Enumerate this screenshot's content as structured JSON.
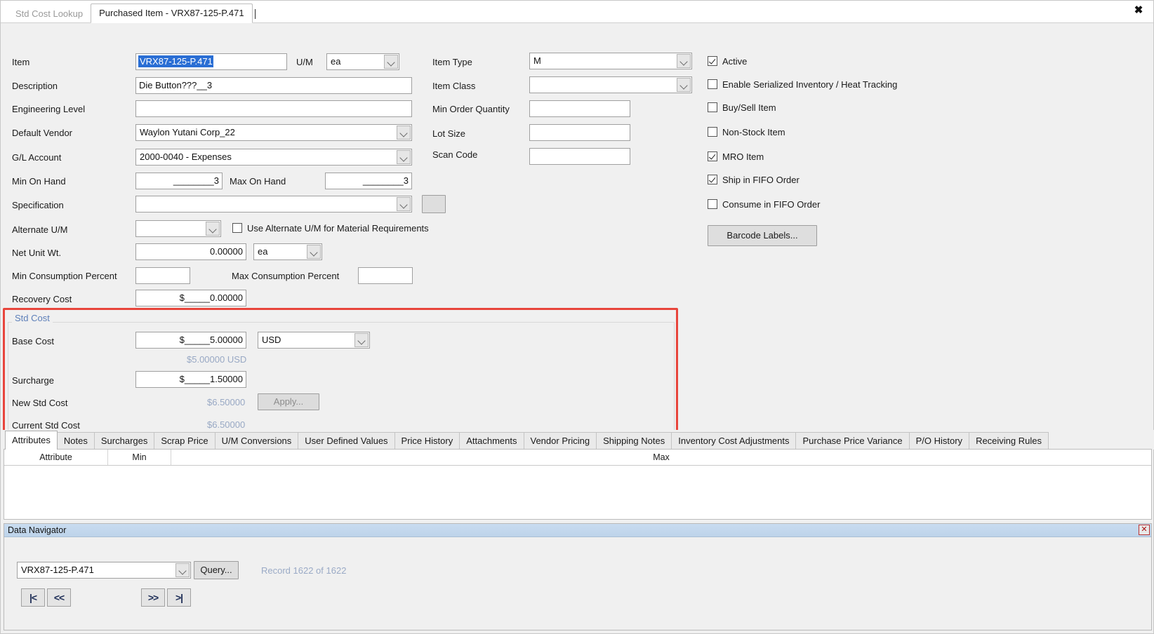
{
  "window": {
    "close_label": "✖"
  },
  "doc_tabs": [
    {
      "label": "Std Cost Lookup",
      "active": false
    },
    {
      "label": "Purchased Item - VRX87-125-P.471",
      "active": true
    }
  ],
  "form": {
    "left_fields": {
      "item_label": "Item",
      "item_value": "VRX87-125-P.471",
      "um_label": "U/M",
      "um_value": "ea",
      "description_label": "Description",
      "description_value": "Die Button???__3",
      "engineering_level_label": "Engineering Level",
      "engineering_level_value": "",
      "default_vendor_label": "Default Vendor",
      "default_vendor_value": "Waylon Yutani Corp_22",
      "gl_account_label": "G/L Account",
      "gl_account_value": "2000-0040 - Expenses",
      "min_on_hand_label": "Min On Hand",
      "min_on_hand_value": "________3",
      "max_on_hand_label": "Max On Hand",
      "max_on_hand_value": "________3",
      "specification_label": "Specification",
      "specification_value": "",
      "alternate_um_label": "Alternate U/M",
      "alternate_um_value": "",
      "use_alt_um_label": "Use Alternate U/M for Material Requirements",
      "use_alt_um_checked": false,
      "net_unit_wt_label": "Net Unit Wt.",
      "net_unit_wt_value": "0.00000",
      "net_unit_wt_um": "ea",
      "min_consumption_label": "Min Consumption Percent",
      "min_consumption_value": "",
      "max_consumption_label": "Max Consumption Percent",
      "max_consumption_value": "",
      "recovery_cost_label": "Recovery Cost",
      "recovery_cost_value": "$_____0.00000"
    },
    "middle_fields": {
      "item_type_label": "Item Type",
      "item_type_value": "M",
      "item_class_label": "Item Class",
      "item_class_value": "",
      "min_order_qty_label": "Min Order Quantity",
      "min_order_qty_value": "",
      "lot_size_label": "Lot Size",
      "lot_size_value": "",
      "scan_code_label": "Scan Code",
      "scan_code_value": ""
    },
    "checkboxes": [
      {
        "label": "Active",
        "checked": true
      },
      {
        "label": "Enable Serialized Inventory / Heat Tracking",
        "checked": false
      },
      {
        "label": "Buy/Sell Item",
        "checked": false
      },
      {
        "label": "Non-Stock Item",
        "checked": false
      },
      {
        "label": "MRO Item",
        "checked": true
      },
      {
        "label": "Ship in FIFO Order",
        "checked": true
      },
      {
        "label": "Consume in FIFO Order",
        "checked": false
      }
    ],
    "barcode_button": "Barcode Labels..."
  },
  "std_cost": {
    "group_title": "Std Cost",
    "base_cost_label": "Base Cost",
    "base_cost_value": "$_____5.00000",
    "currency_value": "USD",
    "base_cost_converted": "$5.00000 USD",
    "surcharge_label": "Surcharge",
    "surcharge_value": "$_____1.50000",
    "new_std_cost_label": "New Std Cost",
    "new_std_cost_value": "$6.50000",
    "apply_button": "Apply...",
    "current_std_cost_label": "Current Std Cost",
    "current_std_cost_value": "$6.50000"
  },
  "bottom_tabs": [
    {
      "label": "Attributes",
      "active": true
    },
    {
      "label": "Notes",
      "active": false
    },
    {
      "label": "Surcharges",
      "active": false
    },
    {
      "label": "Scrap Price",
      "active": false
    },
    {
      "label": "U/M Conversions",
      "active": false
    },
    {
      "label": "User Defined Values",
      "active": false
    },
    {
      "label": "Price History",
      "active": false
    },
    {
      "label": "Attachments",
      "active": false
    },
    {
      "label": "Vendor Pricing",
      "active": false
    },
    {
      "label": "Shipping Notes",
      "active": false
    },
    {
      "label": "Inventory Cost Adjustments",
      "active": false
    },
    {
      "label": "Purchase Price Variance",
      "active": false
    },
    {
      "label": "P/O History",
      "active": false
    },
    {
      "label": "Receiving Rules",
      "active": false
    }
  ],
  "grid": {
    "columns": [
      "Attribute",
      "Min",
      "Max"
    ],
    "rows": []
  },
  "data_navigator": {
    "title": "Data Navigator",
    "close_icon": "✕",
    "record_combo_value": "VRX87-125-P.471",
    "query_button": "Query...",
    "record_info": "Record 1622 of 1622",
    "nav_buttons": [
      {
        "name": "first",
        "label": "|<"
      },
      {
        "name": "previous",
        "label": "<<"
      },
      {
        "name": "next",
        "label": ">>"
      },
      {
        "name": "last",
        "label": ">|"
      }
    ]
  },
  "colors": {
    "highlight_red": "#e8453c",
    "selection_blue": "#2a6ed4",
    "muted_blue": "#98a8c4",
    "group_title_blue": "#5d7fb9"
  }
}
